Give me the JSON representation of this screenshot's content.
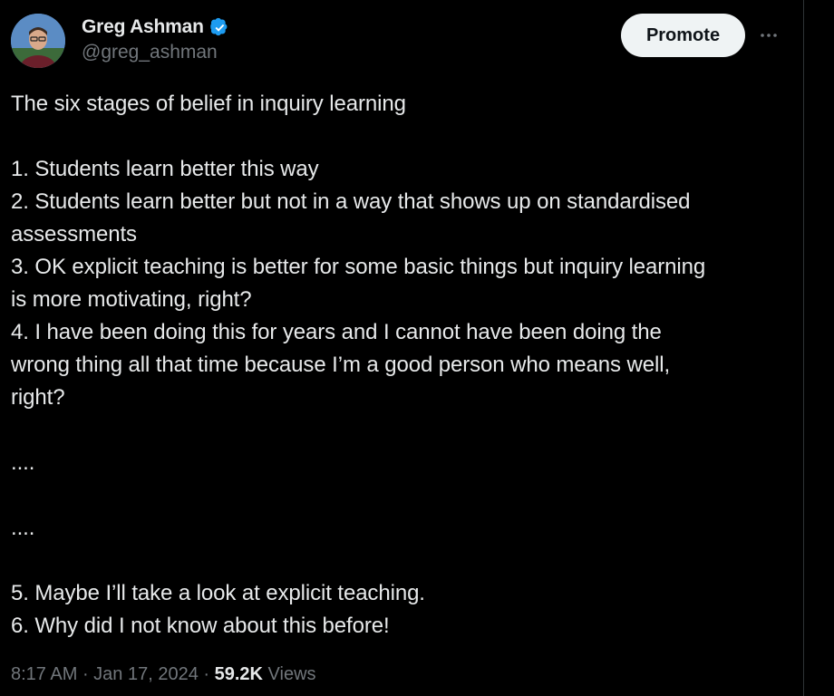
{
  "author": {
    "display_name": "Greg Ashman",
    "handle": "@greg_ashman",
    "verified": true,
    "avatar_icon": "avatar-photo"
  },
  "actions": {
    "promote_label": "Promote",
    "more_icon": "more-horizontal-icon"
  },
  "tweet": {
    "lines": [
      "The six stages of belief in inquiry learning",
      "",
      "1. Students learn better this way",
      "2. Students learn better but not in a way that shows up on standardised",
      "assessments",
      "3. OK explicit teaching is better for some basic things but inquiry learning",
      "is more motivating, right?",
      "4. I have been doing this for years and I cannot have been doing the",
      "wrong thing all that time because I’m a good person who means well,",
      "right?",
      "",
      "....",
      "",
      "....",
      "",
      "5. Maybe I’ll take a look at explicit teaching.",
      "6. Why did I not know about this before!"
    ]
  },
  "meta": {
    "time": "8:17 AM",
    "separator": " · ",
    "date": "Jan 17, 2024",
    "views_count": "59.2K",
    "views_label": " Views"
  },
  "colors": {
    "background": "#000000",
    "text": "#e7e9ea",
    "muted": "#71767b",
    "verified_blue": "#1d9bf0",
    "button_bg": "#eff3f4"
  }
}
